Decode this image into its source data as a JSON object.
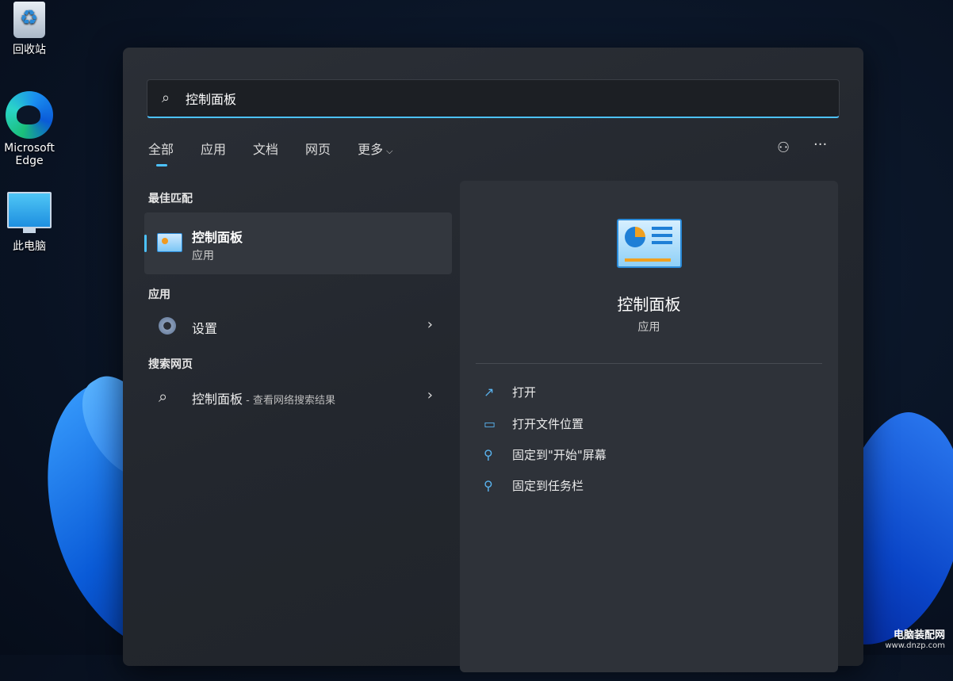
{
  "desktop": {
    "icons": [
      {
        "label": "回收站"
      },
      {
        "label": "Microsoft Edge"
      },
      {
        "label": "此电脑"
      }
    ]
  },
  "search": {
    "value": "控制面板",
    "icon": "search-icon"
  },
  "tabs": [
    {
      "label": "全部",
      "active": true
    },
    {
      "label": "应用"
    },
    {
      "label": "文档"
    },
    {
      "label": "网页"
    },
    {
      "label": "更多"
    }
  ],
  "top_icons": {
    "feedback": "share-person-icon",
    "more": "···"
  },
  "sections": {
    "best_match": "最佳匹配",
    "apps": "应用",
    "web": "搜索网页"
  },
  "best_match_item": {
    "name": "控制面板",
    "type": "应用"
  },
  "app_items": [
    {
      "label": "设置"
    }
  ],
  "web_items": [
    {
      "label": "控制面板",
      "suffix": " - 查看网络搜索结果"
    }
  ],
  "detail": {
    "title": "控制面板",
    "subtitle": "应用",
    "actions": [
      {
        "label": "打开",
        "icon": "open-external-icon"
      },
      {
        "label": "打开文件位置",
        "icon": "folder-icon"
      },
      {
        "label": "固定到\"开始\"屏幕",
        "icon": "pin-icon"
      },
      {
        "label": "固定到任务栏",
        "icon": "pin-icon"
      }
    ]
  },
  "watermark": {
    "line1": "电脑装配网",
    "line2": "www.dnzp.com"
  },
  "colors": {
    "accent": "#4cc2ff",
    "panel": "#2b2f36"
  }
}
